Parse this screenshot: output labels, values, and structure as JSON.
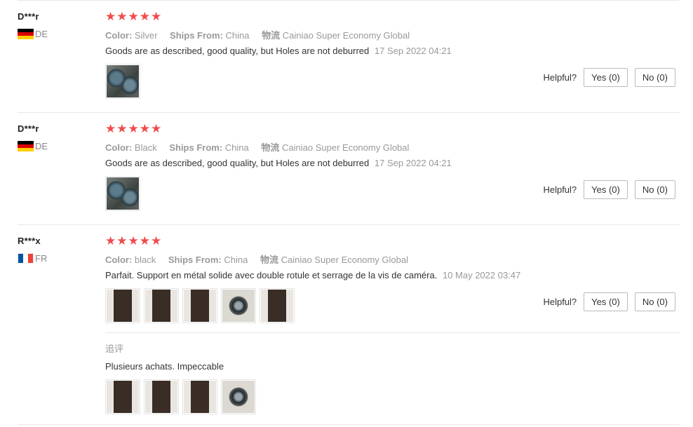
{
  "helpful_label": "Helpful?",
  "stars_text": "★★★★★",
  "labels": {
    "color": "Color:",
    "ships_from": "Ships From:",
    "logistics": "物流"
  },
  "reviews": [
    {
      "user": "D***r",
      "country": "DE",
      "flag": "de",
      "rating": 5,
      "color": "Silver",
      "ships_from": "China",
      "logistics": "Cainiao Super Economy Global",
      "text": "Goods are as described, good quality, but Holes are not deburred",
      "date": "17 Sep 2022 04:21",
      "yes": "Yes (0)",
      "no": "No (0)",
      "photo_count": 1
    },
    {
      "user": "D***r",
      "country": "DE",
      "flag": "de",
      "rating": 5,
      "color": "Black",
      "ships_from": "China",
      "logistics": "Cainiao Super Economy Global",
      "text": "Goods are as described, good quality, but Holes are not deburred",
      "date": "17 Sep 2022 04:21",
      "yes": "Yes (0)",
      "no": "No (0)",
      "photo_count": 1
    },
    {
      "user": "R***x",
      "country": "FR",
      "flag": "fr",
      "rating": 5,
      "color": "black",
      "ships_from": "China",
      "logistics": "Cainiao Super Economy Global",
      "text": "Parfait. Support en métal solide avec double rotule et serrage de la vis de caméra.",
      "date": "10 May 2022 03:47",
      "yes": "Yes (0)",
      "no": "No (0)",
      "photo_count": 5,
      "followup": {
        "title": "追评",
        "text": "Plusieurs achats. Impeccable",
        "photo_count": 4
      }
    }
  ]
}
